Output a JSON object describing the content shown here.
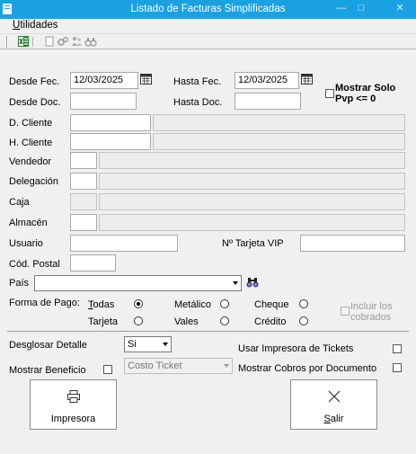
{
  "window": {
    "title": "Listado de Facturas Simplificadas"
  },
  "menu": {
    "utilidades_first": "U",
    "utilidades_rest": "tilidades"
  },
  "toolbar": {
    "icons": [
      "excel-icon",
      "blank-page-icon",
      "gears-icon",
      "people-icon",
      "binoculars-icon"
    ]
  },
  "form": {
    "desde_fec_label": "Desde Fec.",
    "desde_fec_value": "12/03/2025",
    "hasta_fec_label": "Hasta Fec.",
    "hasta_fec_value": "12/03/2025",
    "mostrar_solo_label_1": "Mostrar Solo",
    "mostrar_solo_label_2": "Pvp <= 0",
    "desde_doc_label": "Desde Doc.",
    "desde_doc_value": "",
    "hasta_doc_label": "Hasta Doc.",
    "hasta_doc_value": "",
    "d_cliente_label": "D. Cliente",
    "h_cliente_label": "H. Cliente",
    "vendedor_label": "Vendedor",
    "delegacion_label": "Delegación",
    "caja_label": "Caja",
    "almacen_label": "Almacén",
    "usuario_label": "Usuario",
    "tarjeta_vip_label": "Nº Tarjeta VIP",
    "cod_postal_label": "Cód. Postal",
    "pais_label": "País",
    "pais_value": ""
  },
  "payment": {
    "label": "Forma de Pago:",
    "todas": "Todas",
    "todas_underline": "T",
    "todas_rest": "odas",
    "metalico": "Metálico",
    "cheque": "Cheque",
    "tarjeta": "Tarjeta",
    "vales": "Vales",
    "credito": "Crédito",
    "selected": "Todas",
    "incluir_1": "Incluir los",
    "incluir_2": "cobrados"
  },
  "options": {
    "desglosar_label": "Desglosar Detalle",
    "desglosar_value": "Si",
    "usar_impresora_label": "Usar Impresora de Tickets",
    "mostrar_beneficio_label": "Mostrar Beneficio",
    "costo_value": "Costo Ticket",
    "mostrar_cobros_label": "Mostrar Cobros por Documento"
  },
  "buttons": {
    "impresora": "Impresora",
    "salir_first": "S",
    "salir_rest": "alir"
  }
}
